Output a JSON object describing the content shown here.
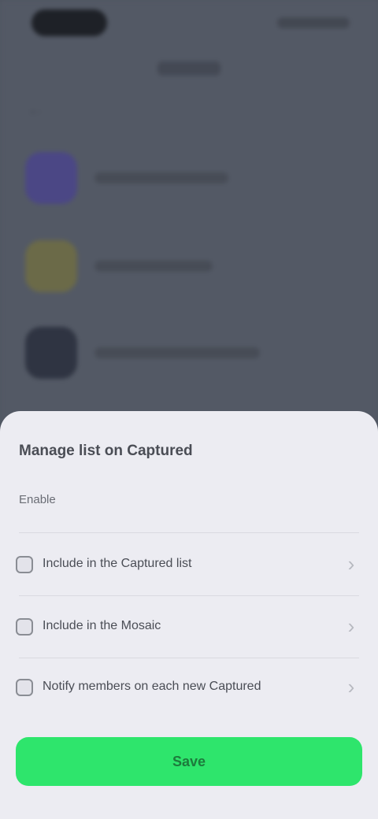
{
  "sheet": {
    "title": "Manage list on Captured",
    "subtitle": "Enable",
    "options": [
      {
        "label": "Include in the Captured list",
        "icon": "checkbox-icon"
      },
      {
        "label": "Include in the Mosaic",
        "icon": "checkbox-icon"
      },
      {
        "label": "Notify members on each new Captured",
        "icon": "checkbox-icon"
      }
    ],
    "primary_button": "Save"
  },
  "background": {
    "avatar_colors": [
      "#4b4785",
      "#6b6a48",
      "#2f3442"
    ]
  }
}
